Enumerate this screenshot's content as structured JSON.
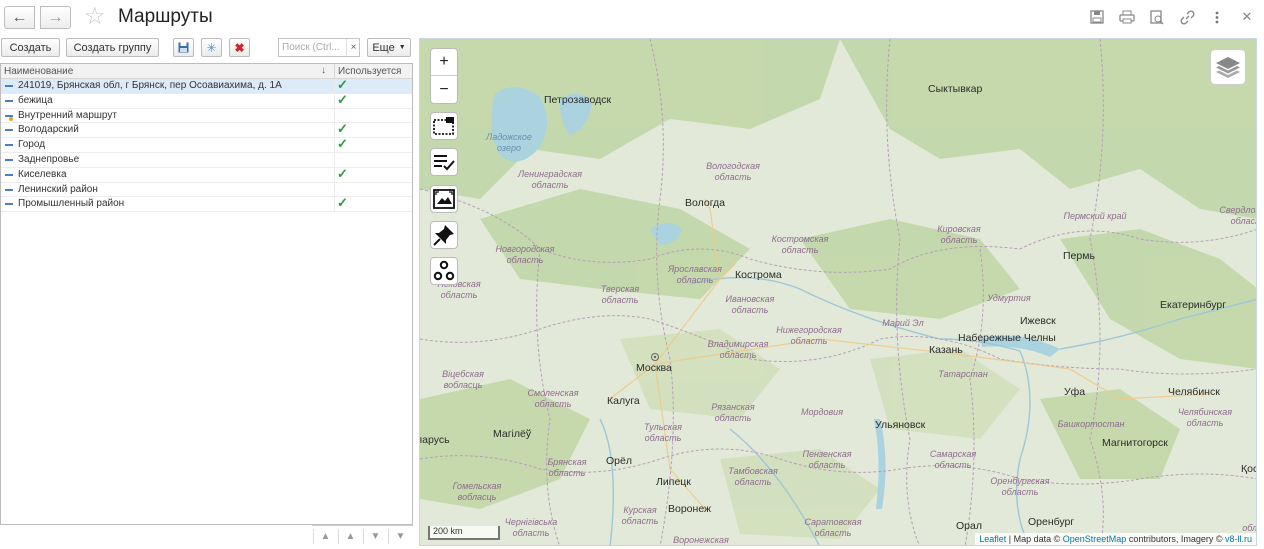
{
  "window": {
    "title": "Маршруты",
    "icons": [
      "save-icon",
      "print-icon",
      "preview-icon",
      "link-icon",
      "more-vertical-icon",
      "close-icon"
    ]
  },
  "toolbar": {
    "create_label": "Создать",
    "create_group_label": "Создать группу",
    "search_placeholder": "Поиск (Ctrl...",
    "search_clear": "×",
    "more_label": "Еще"
  },
  "list": {
    "col_name": "Наименование",
    "col_used": "Используется",
    "rows": [
      {
        "name": "241019, Брянская обл, г Брянск, пер Осоавиахима, д. 1А",
        "used": true,
        "selected": true,
        "folder": false
      },
      {
        "name": "бежица",
        "used": true,
        "selected": false,
        "folder": false
      },
      {
        "name": "Внутренний маршрут",
        "used": false,
        "selected": false,
        "folder": true
      },
      {
        "name": "Володарский",
        "used": true,
        "selected": false,
        "folder": false
      },
      {
        "name": "Город",
        "used": true,
        "selected": false,
        "folder": false
      },
      {
        "name": "Заднепровье",
        "used": false,
        "selected": false,
        "folder": false
      },
      {
        "name": "Киселевка",
        "used": true,
        "selected": false,
        "folder": false
      },
      {
        "name": "Ленинский район",
        "used": false,
        "selected": false,
        "folder": false
      },
      {
        "name": "Промышленный район",
        "used": true,
        "selected": false,
        "folder": false
      }
    ]
  },
  "map": {
    "zoom_in": "+",
    "zoom_out": "−",
    "scale": "200 km",
    "attribution": {
      "leaflet": "Leaflet",
      "sep1": " | Map data © ",
      "osm": "OpenStreetMap",
      "mid": " contributors, Imagery © ",
      "v8": "v8-ll.ru"
    },
    "cities": [
      "Петрозаводск",
      "Сыктывкар",
      "Вологда",
      "Кострома",
      "Пермь",
      "Екатеринбург",
      "Ижевск",
      "Набережные Челны",
      "Казань",
      "Москва",
      "Калуга",
      "Ульяновск",
      "Уфа",
      "Челябинск",
      "Магнитогорск",
      "Магілёў",
      "Орёл",
      "Липецк",
      "Воронеж",
      "Орал",
      "Оренбург",
      "Қоста",
      "ларусь"
    ],
    "regions": [
      "Вологодская область",
      "Ленинградская область",
      "Новгородская область",
      "Псковская область",
      "Ярославская область",
      "Тверская область",
      "Костромская область",
      "Ивановская область",
      "Кировская область",
      "Пермский край",
      "Свердловская область",
      "Удмуртия",
      "Нижегородская область",
      "Марий Эл",
      "Владимирская область",
      "Смоленская область",
      "Віцебская вобласць",
      "Татарстан",
      "Тульская область",
      "Рязанская область",
      "Мордовия",
      "Башкортостан",
      "Челябинская область",
      "Брянская область",
      "Тамбовская область",
      "Пензенская область",
      "Самарская область",
      "Гомельская вобласць",
      "Курская область",
      "Оренбургская область",
      "Саратовская область",
      "Чернігівська область",
      "Воронежская область",
      "Ладожское озеро",
      "облы"
    ]
  }
}
